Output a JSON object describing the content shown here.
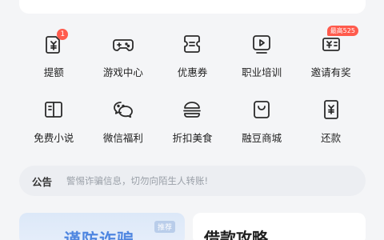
{
  "grid": {
    "items": [
      {
        "label": "提额",
        "icon": "withdraw-limit-icon",
        "badge": "1"
      },
      {
        "label": "游戏中心",
        "icon": "gamepad-icon"
      },
      {
        "label": "优惠券",
        "icon": "coupon-icon"
      },
      {
        "label": "职业培训",
        "icon": "video-training-icon"
      },
      {
        "label": "邀请有奖",
        "icon": "invite-card-icon",
        "badge": "最高525"
      },
      {
        "label": "免费小说",
        "icon": "book-icon"
      },
      {
        "label": "微信福利",
        "icon": "wechat-icon"
      },
      {
        "label": "折扣美食",
        "icon": "burger-icon"
      },
      {
        "label": "融豆商城",
        "icon": "shopping-bag-icon"
      },
      {
        "label": "还款",
        "icon": "repay-icon"
      }
    ]
  },
  "notice": {
    "title": "公告",
    "text": "警惕诈骗信息，切勿向陌生人转账!"
  },
  "cards": {
    "left_title": "谨防诈骗",
    "left_tag": "推荐",
    "right_title": "借款攻略"
  },
  "colors": {
    "background": "#f4f5f7",
    "icon_stroke": "#2b2b2b",
    "badge": "#ff5b4d",
    "accent_blue": "#4f86e0"
  }
}
